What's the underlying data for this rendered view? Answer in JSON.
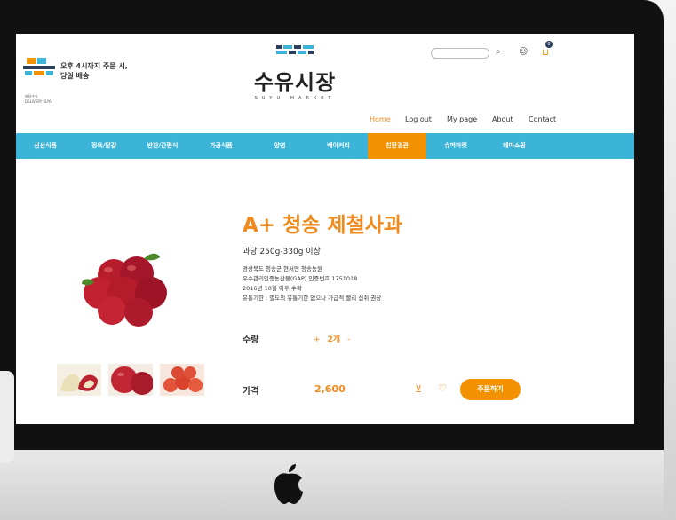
{
  "header": {
    "promo_line1": "오후 4시까지 주문 시,",
    "promo_line2": "당일 배송",
    "delivery_badge_line1": "배달수유",
    "delivery_badge_line2": "DELIVERY SUYU",
    "logo_main": "수유시장",
    "logo_sub": "SUYU MARKET",
    "cart_count": "0"
  },
  "topnav": {
    "home": "Home",
    "logout": "Log out",
    "mypage": "My page",
    "about": "About",
    "contact": "Contact"
  },
  "categories": [
    "신선식품",
    "정육/달걀",
    "반찬/간편식",
    "가공식품",
    "양념",
    "베이커리",
    "친환경관",
    "슈퍼마켓",
    "테마쇼핑"
  ],
  "active_category_index": 6,
  "product": {
    "title": "A+ 청송 제철사과",
    "subtitle": "과당 250g-330g 이상",
    "details": [
      "경상북도 청송군 현서면 청송농원",
      "우수관리인증농산물(GAP) 인증번호 1751018",
      "2016년 10월 이후 수확",
      "유통기한 : 별도의 유통기한 없으나 가급적 빨리 섭취 권장"
    ],
    "qty_label": "수량",
    "qty_minus": "+",
    "qty_value": "2개",
    "qty_plus": "-",
    "price_label": "가격",
    "price_value": "2,600",
    "order_button": "주문하기"
  },
  "icons": {
    "search": "search-icon",
    "user": "user-icon",
    "cart": "cart-icon",
    "heart": "heart-icon",
    "add_cart": "add-cart-icon"
  },
  "colors": {
    "accent": "#f39200",
    "category_bar": "#3bb4d8",
    "title": "#f08a1c"
  }
}
